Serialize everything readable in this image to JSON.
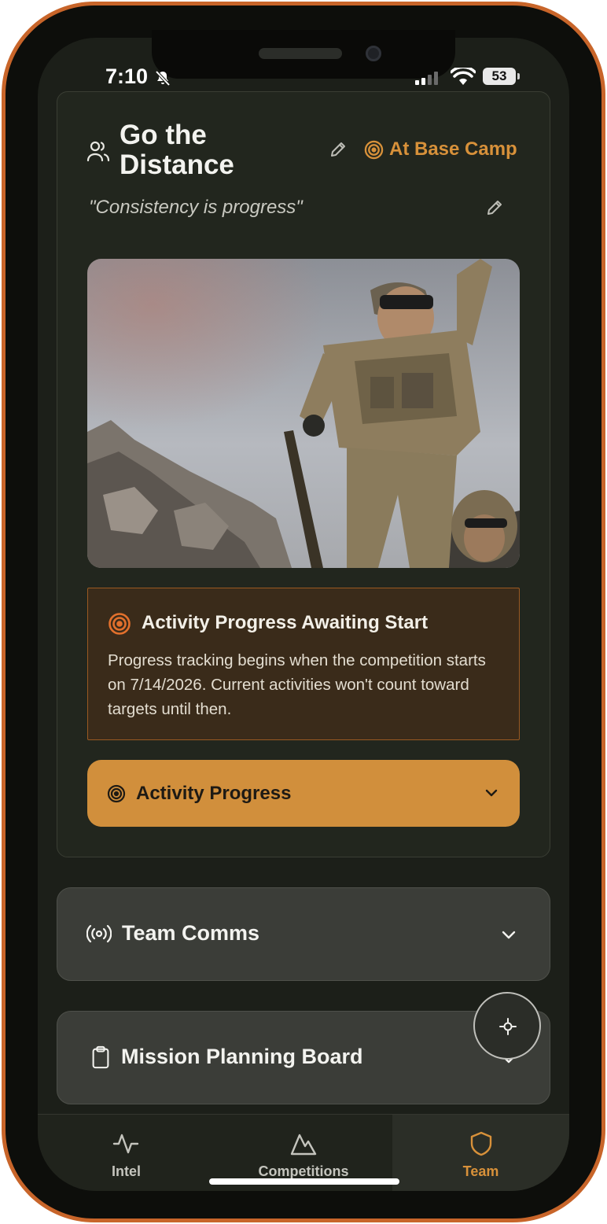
{
  "status_bar": {
    "time": "7:10",
    "battery": "53"
  },
  "team_card": {
    "title": "Go the Distance",
    "status": "At Base Camp",
    "motto": "\"Consistency is progress\""
  },
  "alert": {
    "title": "Activity Progress Awaiting Start",
    "body": "Progress tracking begins when the competition starts on 7/14/2026. Current activities won't count toward targets until then."
  },
  "activity_progress": {
    "label": "Activity Progress"
  },
  "sections": {
    "team_comms": "Team Comms",
    "mission_board": "Mission Planning Board"
  },
  "tabs": [
    {
      "label": "Intel",
      "icon": "activity-icon"
    },
    {
      "label": "Competitions",
      "icon": "mountain-icon"
    },
    {
      "label": "Team",
      "icon": "shield-icon",
      "active": true
    }
  ],
  "colors": {
    "accent": "#d18f3c",
    "background": "#1c1f19",
    "card": "#22261e",
    "frame": "#c8652a"
  }
}
